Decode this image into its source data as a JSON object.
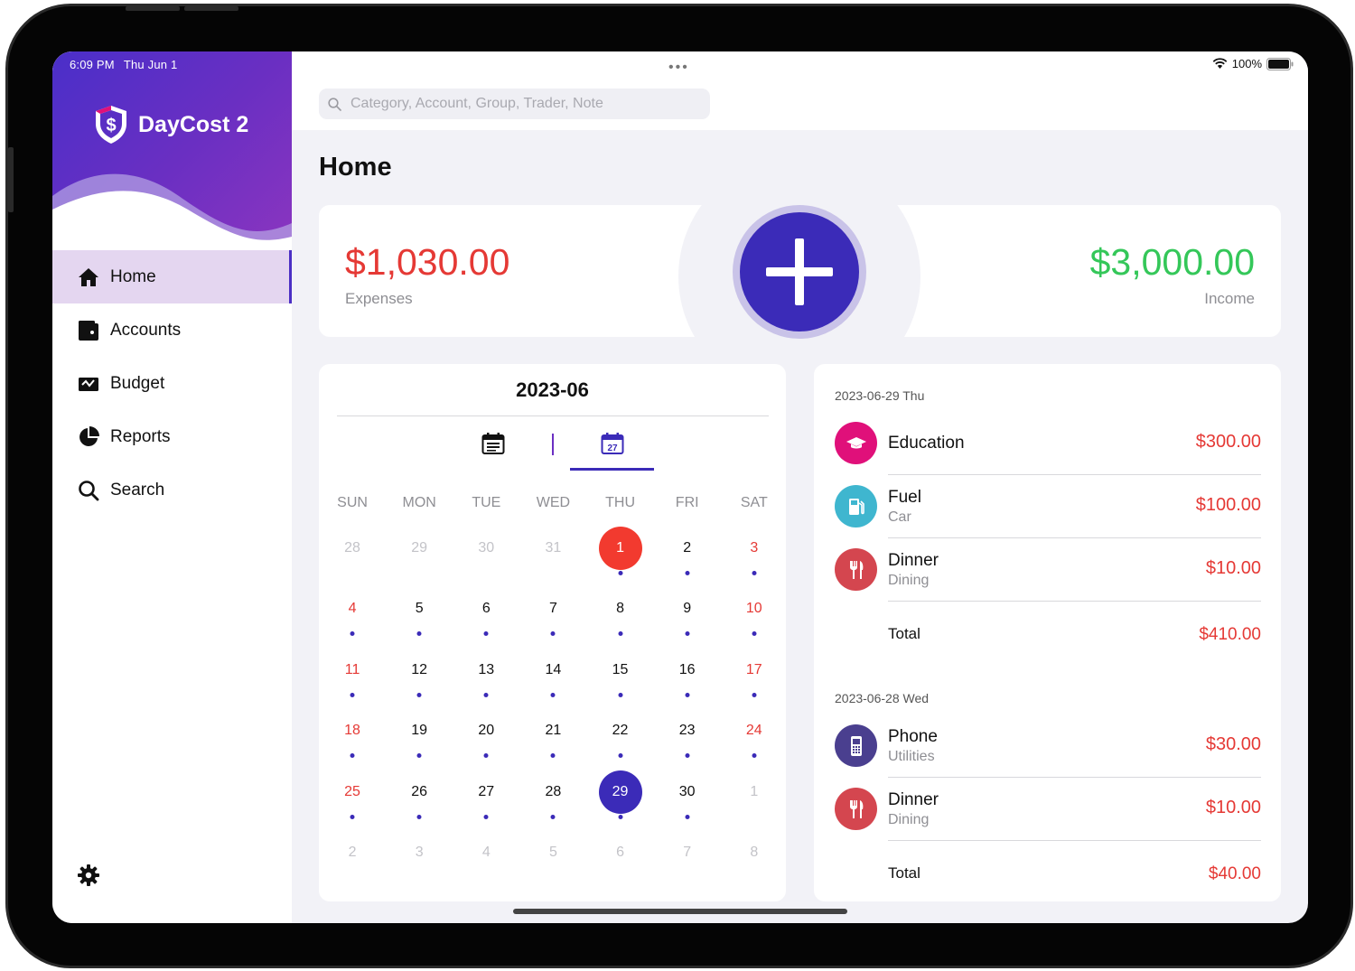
{
  "status": {
    "time": "6:09 PM",
    "date": "Thu Jun 1",
    "battery": "100%"
  },
  "app": {
    "name": "DayCost 2"
  },
  "sidebar": {
    "items": [
      {
        "label": "Home",
        "icon": "home-icon"
      },
      {
        "label": "Accounts",
        "icon": "wallet-icon"
      },
      {
        "label": "Budget",
        "icon": "budget-icon"
      },
      {
        "label": "Reports",
        "icon": "pie-chart-icon"
      },
      {
        "label": "Search",
        "icon": "search-icon"
      }
    ],
    "active": "Home",
    "settings_icon": "gear-icon"
  },
  "search": {
    "placeholder": "Category, Account, Group, Trader, Note",
    "value": ""
  },
  "page": {
    "title": "Home"
  },
  "summary": {
    "expenses": {
      "amount": "$1,030.00",
      "label": "Expenses",
      "color": "#e53935"
    },
    "income": {
      "amount": "$3,000.00",
      "label": "Income",
      "color": "#34c759"
    },
    "add_icon": "plus-icon"
  },
  "calendar": {
    "title": "2023-06",
    "weekdays": [
      "SUN",
      "MON",
      "TUE",
      "WED",
      "THU",
      "FRI",
      "SAT"
    ],
    "weeks": [
      [
        "28",
        "29",
        "30",
        "31",
        "1",
        "2",
        "3"
      ],
      [
        "4",
        "5",
        "6",
        "7",
        "8",
        "9",
        "10"
      ],
      [
        "11",
        "12",
        "13",
        "14",
        "15",
        "16",
        "17"
      ],
      [
        "18",
        "19",
        "20",
        "21",
        "22",
        "23",
        "24"
      ],
      [
        "25",
        "26",
        "27",
        "28",
        "29",
        "30",
        "1"
      ],
      [
        "2",
        "3",
        "4",
        "5",
        "6",
        "7",
        "8"
      ]
    ],
    "view_icons": [
      "list-calendar-icon",
      "month-calendar-icon"
    ],
    "month_view_day": "27"
  },
  "transactions": {
    "groups": [
      {
        "date": "2023-06-29 Thu",
        "items": [
          {
            "title": "Education",
            "subtitle": "",
            "amount": "$300.00",
            "icon": "graduation-cap-icon",
            "color": "#e0107a"
          },
          {
            "title": "Fuel",
            "subtitle": "Car",
            "amount": "$100.00",
            "icon": "fuel-pump-icon",
            "color": "#3fb6cf"
          },
          {
            "title": "Dinner",
            "subtitle": "Dining",
            "amount": "$10.00",
            "icon": "utensils-icon",
            "color": "#d4464f"
          }
        ],
        "total_label": "Total",
        "total": "$410.00"
      },
      {
        "date": "2023-06-28 Wed",
        "items": [
          {
            "title": "Phone",
            "subtitle": "Utilities",
            "amount": "$30.00",
            "icon": "phone-icon",
            "color": "#4a3f8f"
          },
          {
            "title": "Dinner",
            "subtitle": "Dining",
            "amount": "$10.00",
            "icon": "utensils-icon",
            "color": "#d4464f"
          }
        ],
        "total_label": "Total",
        "total": "$40.00"
      }
    ]
  }
}
